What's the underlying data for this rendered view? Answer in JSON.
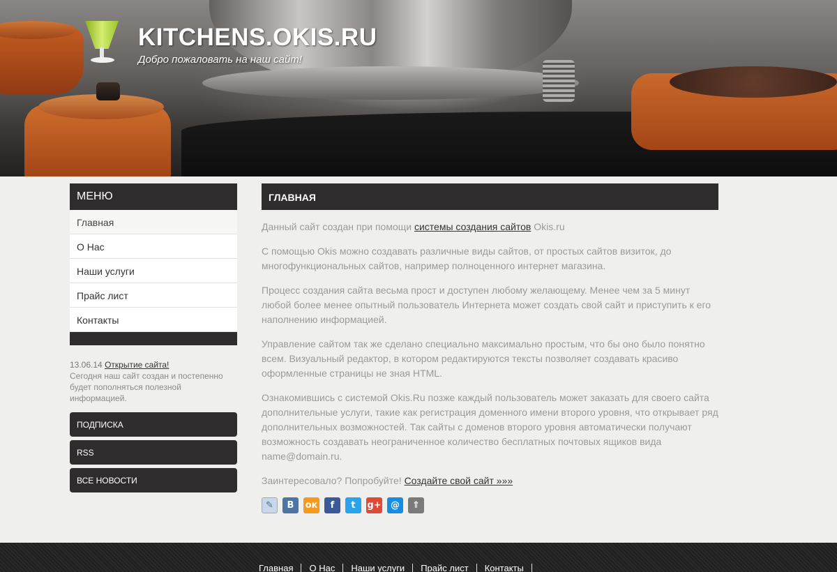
{
  "header": {
    "title": "KITCHENS.OKIS.RU",
    "subtitle": "Добро пожаловать на наш сайт!"
  },
  "sidebar": {
    "menu_title": "МЕНЮ",
    "items": [
      {
        "label": "Главная"
      },
      {
        "label": "О Нас"
      },
      {
        "label": "Наши услуги"
      },
      {
        "label": "Прайс лист"
      },
      {
        "label": "Контакты"
      }
    ],
    "news": {
      "date": "13.06.14",
      "link": "Открытие сайта!",
      "text": "Сегодня наш сайт создан и постепенно будет пополняться полезной информацией."
    },
    "buttons": {
      "subscribe": "ПОДПИСКА",
      "rss": "RSS",
      "all_news": "ВСЕ НОВОСТИ"
    }
  },
  "main": {
    "heading": "ГЛАВНАЯ",
    "p1_before": "Данный сайт создан при помощи ",
    "p1_link": "системы создания сайтов",
    "p1_after": " Okis.ru",
    "p2": "С помощью Okis можно создавать различные виды сайтов, от простых сайтов визиток, до многофункциональных сайтов, например полноценного интернет магазина.",
    "p3": "Процесс создания сайта весьма прост и доступен любому желающему. Менее чем за 5 минут любой более менее опытный пользователь Интернета может создать свой сайт и приступить к его наполнению информацией.",
    "p4": "Управление сайтом так же сделано специально максимально простым, что бы оно было понятно всем. Визуальный редактор, в котором редактируются тексты позволяет создавать красиво оформленные страницы не зная HTML.",
    "p5": "Ознакомившись с системой Okis.Ru позже каждый пользователь может заказать для своего сайта дополнительные услуги, такие как регистрация доменного имени второго уровня, что открывает ряд дополнительных возможностей. Так сайты с доменов второго уровня автоматически получают возможность создавать неограниченное количество бесплатных почтовых ящиков вида name@domain.ru.",
    "p6_before": "Заинтересовало? Попробуйте! ",
    "p6_link": "Создайте свой сайт »»»"
  },
  "share": {
    "icons": [
      {
        "name": "livejournal-icon",
        "glyph": "✎",
        "color": "#c8d8e8"
      },
      {
        "name": "vkontakte-icon",
        "glyph": "В",
        "color": "#4c75a3"
      },
      {
        "name": "odnoklassniki-icon",
        "glyph": "ок",
        "color": "#f59a1c"
      },
      {
        "name": "facebook-icon",
        "glyph": "f",
        "color": "#3b5998"
      },
      {
        "name": "twitter-icon",
        "glyph": "t",
        "color": "#2aa3ef"
      },
      {
        "name": "google-plus-icon",
        "glyph": "g+",
        "color": "#dc4a38"
      },
      {
        "name": "mail-ru-icon",
        "glyph": "@",
        "color": "#168de2"
      },
      {
        "name": "bookmark-icon",
        "glyph": "⇑",
        "color": "#7a7a7a"
      }
    ]
  },
  "footer": {
    "nav": [
      "Главная",
      "О Нас",
      "Наши услуги",
      "Прайс лист",
      "Контакты"
    ]
  }
}
